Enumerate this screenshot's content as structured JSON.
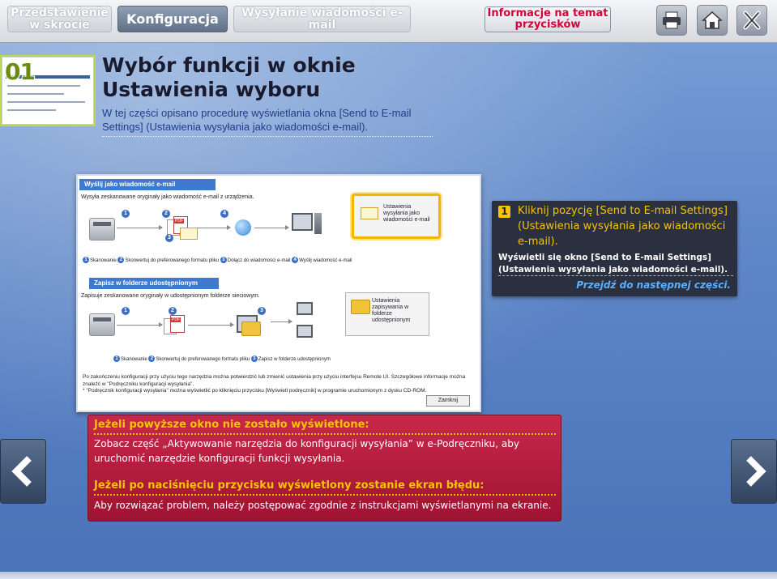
{
  "header": {
    "tabs": [
      {
        "label": "Przedstawienie w skrócie",
        "active": false
      },
      {
        "label": "Konfiguracja",
        "active": true
      },
      {
        "label": "Wysyłanie wiadomości e-mail",
        "active": false
      }
    ],
    "info_button": "Informacje na temat przycisków",
    "icons": [
      "print-icon",
      "home-icon",
      "close-icon"
    ]
  },
  "section": {
    "number": "01",
    "title": "Wybór funkcji w oknie Ustawienia wyboru",
    "subtitle": "W tej części opisano procedurę wyświetlania okna [Send to E-mail Settings] (Ustawienia wysyłania jako wiadomości e-mail)."
  },
  "screenshot": {
    "email_header": "Wyślij jako wiadomość e-mail",
    "email_desc": "Wysyła zeskanowane oryginały jako wiadomość e-mail z urządzenia.",
    "email_button": "Ustawienia wysyłania jako wiadomości e-mail",
    "email_steps": [
      "Skanowanie",
      "Skonwertuj do preferowanego formatu pliku",
      "Dołącz do wiadomości e-mail",
      "Wyślij wiadomość e-mail"
    ],
    "folder_header": "Zapisz w folderze udostępnionym",
    "folder_desc": "Zapisuje zeskanowane oryginały w udostępnionym folderze sieciowym.",
    "folder_button": "Ustawienia zapisywania w folderze udostępnionym",
    "folder_steps": [
      "Skanowanie",
      "Skonwertuj do preferowanego formatu pliku",
      "Zapisz w folderze udostępnionym"
    ],
    "note": "Po zakończeniu konfiguracji przy użyciu tego narzędzia można potwierdzić lub zmienić ustawienia przy użyciu interfejsu Remote UI. Szczegółowe informacje można znaleźć w \"Podręczniku konfiguracji wysyłania\".\n* \"Podręcznik konfiguracji wysyłania\" można wyświetlić po kliknięciu przycisku [Wyświetl podręcznik] w programie uruchomionym z dysku CD-ROM.",
    "close_button": "Zamknij"
  },
  "step": {
    "number": "1",
    "main": "Kliknij pozycję [Send to E-mail Settings] (Ustawienia wysyłania jako wiadomości e-mail).",
    "sub": "Wyświetli się okno [Send to E-mail Settings] (Ustawienia wysyłania jako wiadomości e-mail).",
    "next_link": "Przejdź do następnej części."
  },
  "warning": {
    "heading1": "Jeżeli powyższe okno nie zostało wyświetlone:",
    "text1": "Zobacz część „Aktywowanie narzędzia do konfiguracji wysyłania” w e-Podręczniku, aby uruchomić narzędzie konfiguracji funkcji wysyłania.",
    "heading2": "Jeżeli po naciśnięciu przycisku wyświetlony zostanie ekran błędu:",
    "text2": "Aby rozwiązać problem, należy postępować zgodnie z instrukcjami wyświetlanymi na ekranie."
  },
  "nav": {
    "prev": "chevron-left-icon",
    "next": "chevron-right-icon"
  },
  "colors": {
    "accent_yellow": "#f6c400",
    "warning_red": "#b01e3e",
    "callout_dark": "#2b3040",
    "title_green": "#6a8a10"
  }
}
